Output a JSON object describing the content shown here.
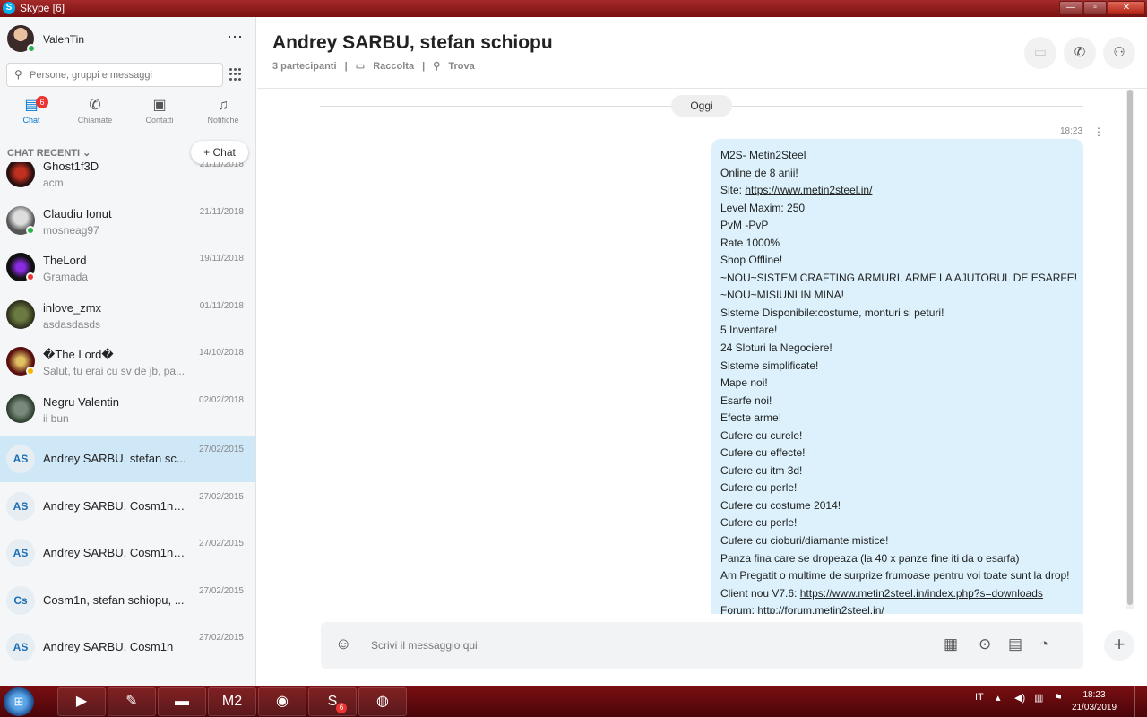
{
  "window": {
    "title": "Skype [6]",
    "icon": "S",
    "minimize": "—",
    "maximize": "▫",
    "close": "✕"
  },
  "profile": {
    "name": "ValenTin",
    "more": "⋯"
  },
  "search": {
    "placeholder": "Persone, gruppi e messaggi"
  },
  "nav": {
    "chat": {
      "label": "Chat",
      "badge": "6",
      "icon": "chat-bubble-icon"
    },
    "calls": {
      "label": "Chiamate",
      "icon": "phone-icon"
    },
    "contacts": {
      "label": "Contatti",
      "icon": "contacts-icon"
    },
    "notifications": {
      "label": "Notifiche",
      "icon": "bell-icon"
    }
  },
  "recent": {
    "header": "CHAT RECENTI",
    "new_chat": "Chat"
  },
  "chats": [
    {
      "name": "Ghost1f3D",
      "message": "acm",
      "date": "21/11/2018"
    },
    {
      "name": "Claudiu Ionut",
      "message": "mosneag97",
      "date": "21/11/2018",
      "presence": "#2bb34a"
    },
    {
      "name": "TheLord",
      "message": "Gramada",
      "date": "19/11/2018",
      "presence": "#e33"
    },
    {
      "name": "inlove_zmx",
      "message": "asdasdasds",
      "date": "01/11/2018"
    },
    {
      "name": "�The Lord�",
      "message": "Salut, tu erai cu sv de jb, pa...",
      "date": "14/10/2018",
      "presence": "#f5b800"
    },
    {
      "name": "Negru Valentin",
      "message": "ii bun",
      "date": "02/02/2018"
    },
    {
      "name": "Andrey SARBU, stefan sc...",
      "initials": "AS",
      "date": "27/02/2015",
      "selected": true
    },
    {
      "name": "Andrey SARBU, Cosm1n, ...",
      "initials": "AS",
      "date": "27/02/2015"
    },
    {
      "name": "Andrey SARBU, Cosm1n, ...",
      "initials": "AS",
      "date": "27/02/2015"
    },
    {
      "name": "Cosm1n, stefan schiopu, ...",
      "initials": "Cs",
      "date": "27/02/2015"
    },
    {
      "name": "Andrey SARBU, Cosm1n",
      "initials": "AS",
      "date": "27/02/2015"
    }
  ],
  "conversation": {
    "title": "Andrey SARBU, stefan schiopu",
    "participants": "3 partecipanti",
    "gallery": "Raccolta",
    "find": "Trova",
    "day": "Oggi",
    "time": "18:23",
    "lines": [
      "M2S- Metin2Steel",
      "Online de 8 anii!",
      "Site: |https://www.metin2steel.in/",
      "Level Maxim: 250",
      "PvM -PvP",
      "Rate 1000%",
      "Shop Offline!",
      "~NOU~SISTEM CRAFTING ARMURI, ARME LA AJUTORUL DE ESARFE!",
      "~NOU~MISIUNI IN MINA!",
      "Sisteme Disponibile:costume, monturi si peturi!",
      "5 Inventare!",
      "24 Sloturi la Negociere!",
      "Sisteme simplificate!",
      "Mape noi!",
      "Esarfe noi!",
      "Efecte arme!",
      "Cufere cu curele!",
      "Cufere cu effecte!",
      "Cufere cu itm 3d!",
      "Cufere cu perle!",
      "Cufere cu costume 2014!",
      "Cufere cu perle!",
      "Cufere cu cioburi/diamante mistice!",
      "Panza fina care se dropeaza (la 40 x panze fine iti da o esarfa)",
      "Am Pregatit o multime de surprize frumoase pentru voi toate sunt la drop!",
      "Client nou V7.6: |https://www.metin2steel.in/index.php?s=downloads",
      "Forum: http://forum.metin2steel.in/"
    ]
  },
  "composer": {
    "placeholder": "Scrivi il messaggio qui"
  },
  "taskbar": {
    "lang": "IT",
    "time": "18:23",
    "date": "21/03/2019",
    "skype_badge": "6",
    "m2_label": "M2"
  },
  "colors": {
    "accent": "#0078d4",
    "bubble": "#dcf1fb",
    "selected": "#cfe8f7",
    "taskbar": "#6a0a0d"
  }
}
